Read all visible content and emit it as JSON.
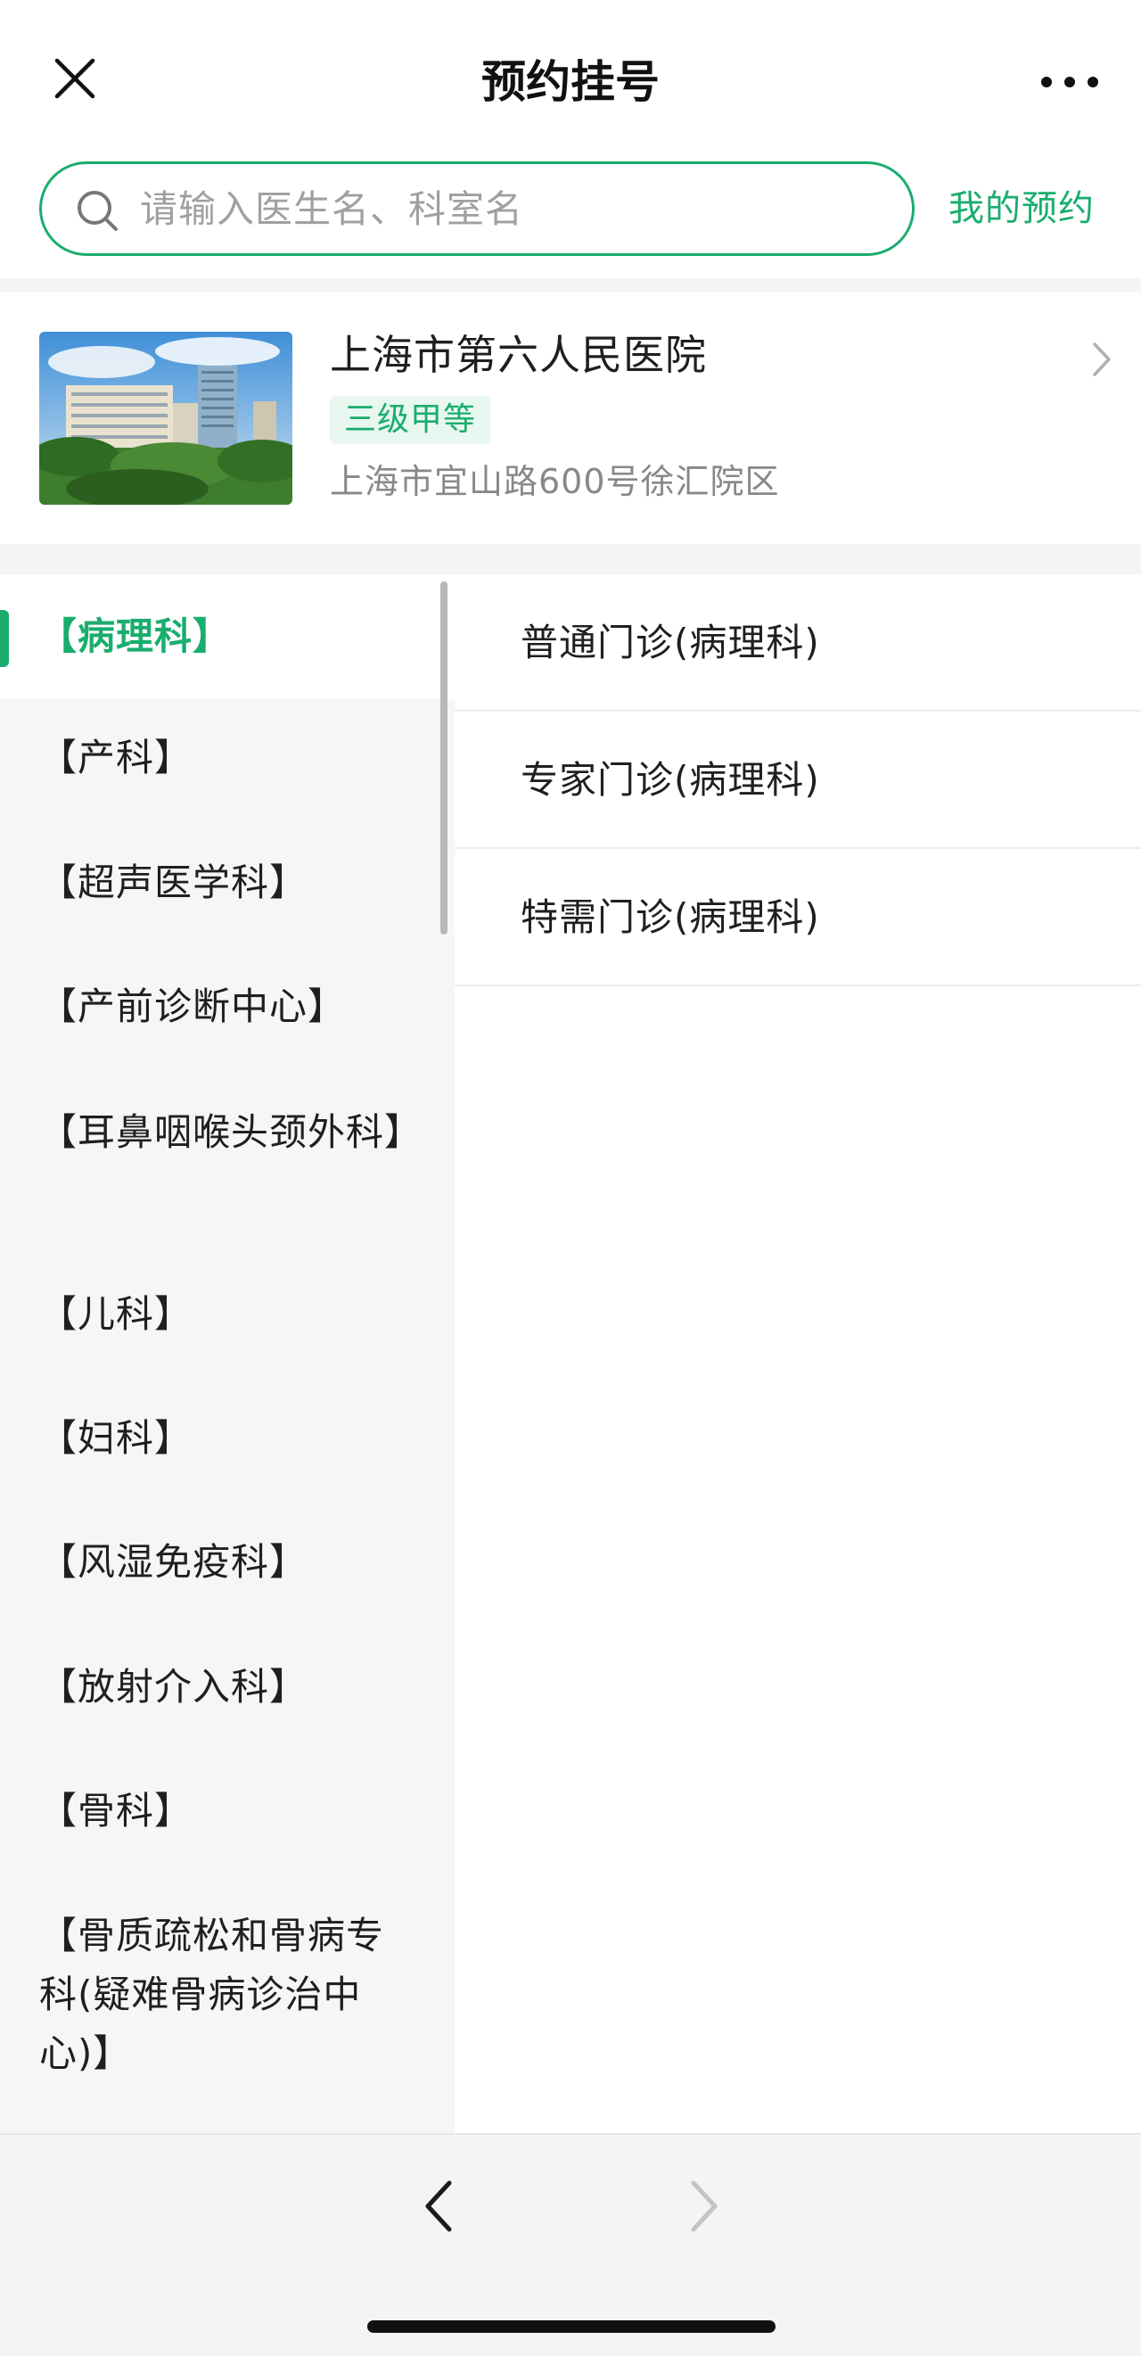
{
  "header": {
    "title": "预约挂号",
    "close_icon": "close-icon",
    "more_icon": "more-icon"
  },
  "search": {
    "placeholder": "请输入医生名、科室名",
    "my_appointments_label": "我的预约"
  },
  "hospital": {
    "name": "上海市第六人民医院",
    "grade": "三级甲等",
    "address": "上海市宜山路600号徐汇院区"
  },
  "departments": [
    {
      "label": "【病理科】",
      "active": true
    },
    {
      "label": "【产科】"
    },
    {
      "label": "【超声医学科】"
    },
    {
      "label": "【产前诊断中心】"
    },
    {
      "label": "【耳鼻咽喉头颈外科】"
    },
    {
      "label": "【儿科】"
    },
    {
      "label": "【妇科】"
    },
    {
      "label": "【风湿免疫科】"
    },
    {
      "label": "【放射介入科】"
    },
    {
      "label": "【骨科】"
    },
    {
      "label": "【骨质疏松和骨病专科(疑难骨病诊治中心)】"
    }
  ],
  "clinics": [
    {
      "label": "普通门诊(病理科)"
    },
    {
      "label": "专家门诊(病理科)"
    },
    {
      "label": "特需门诊(病理科)"
    }
  ],
  "colors": {
    "accent": "#1aad6e",
    "list_bg": "#f5f6f8",
    "text": "#1f1f1f",
    "muted": "#888888"
  },
  "bottom_nav": {
    "back_icon": "chevron-left-icon",
    "forward_icon": "chevron-right-icon"
  }
}
